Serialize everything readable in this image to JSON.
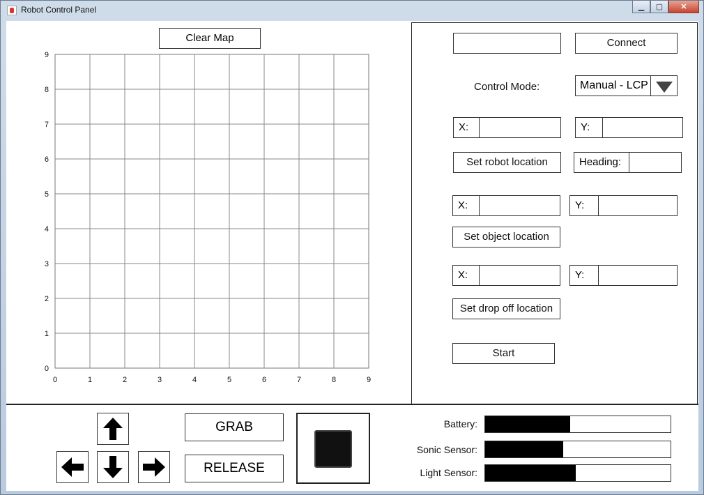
{
  "window": {
    "title": "Robot Control Panel",
    "min_glyph": "▁",
    "max_glyph": "▢",
    "close_glyph": "✕"
  },
  "map": {
    "clear_label": "Clear Map",
    "chart_data": {
      "type": "scatter",
      "title": "",
      "xlabel": "",
      "ylabel": "",
      "xlim": [
        0,
        9
      ],
      "ylim": [
        0,
        9
      ],
      "x_ticks": [
        "0",
        "1",
        "2",
        "3",
        "4",
        "5",
        "6",
        "7",
        "8",
        "9"
      ],
      "y_ticks": [
        "0",
        "1",
        "2",
        "3",
        "4",
        "5",
        "6",
        "7",
        "8",
        "9"
      ],
      "grid": true,
      "series": []
    }
  },
  "connection": {
    "address_value": "",
    "connect_label": "Connect"
  },
  "control_mode": {
    "label": "Control Mode:",
    "selected": "Manual - LCP"
  },
  "robot_location": {
    "x_label": "X:",
    "x_value": "",
    "y_label": "Y:",
    "y_value": "",
    "set_label": "Set robot location",
    "heading_label": "Heading:",
    "heading_value": ""
  },
  "object_location": {
    "x_label": "X:",
    "x_value": "",
    "y_label": "Y:",
    "y_value": "",
    "set_label": "Set object location"
  },
  "dropoff_location": {
    "x_label": "X:",
    "x_value": "",
    "y_label": "Y:",
    "y_value": "",
    "set_label": "Set drop off  location"
  },
  "start_label": "Start",
  "controls": {
    "grab_label": "GRAB",
    "release_label": "RELEASE"
  },
  "sensors": [
    {
      "label": "Battery:",
      "level": 0.46
    },
    {
      "label": "Sonic Sensor:",
      "level": 0.42
    },
    {
      "label": "Light Sensor:",
      "level": 0.49
    }
  ]
}
